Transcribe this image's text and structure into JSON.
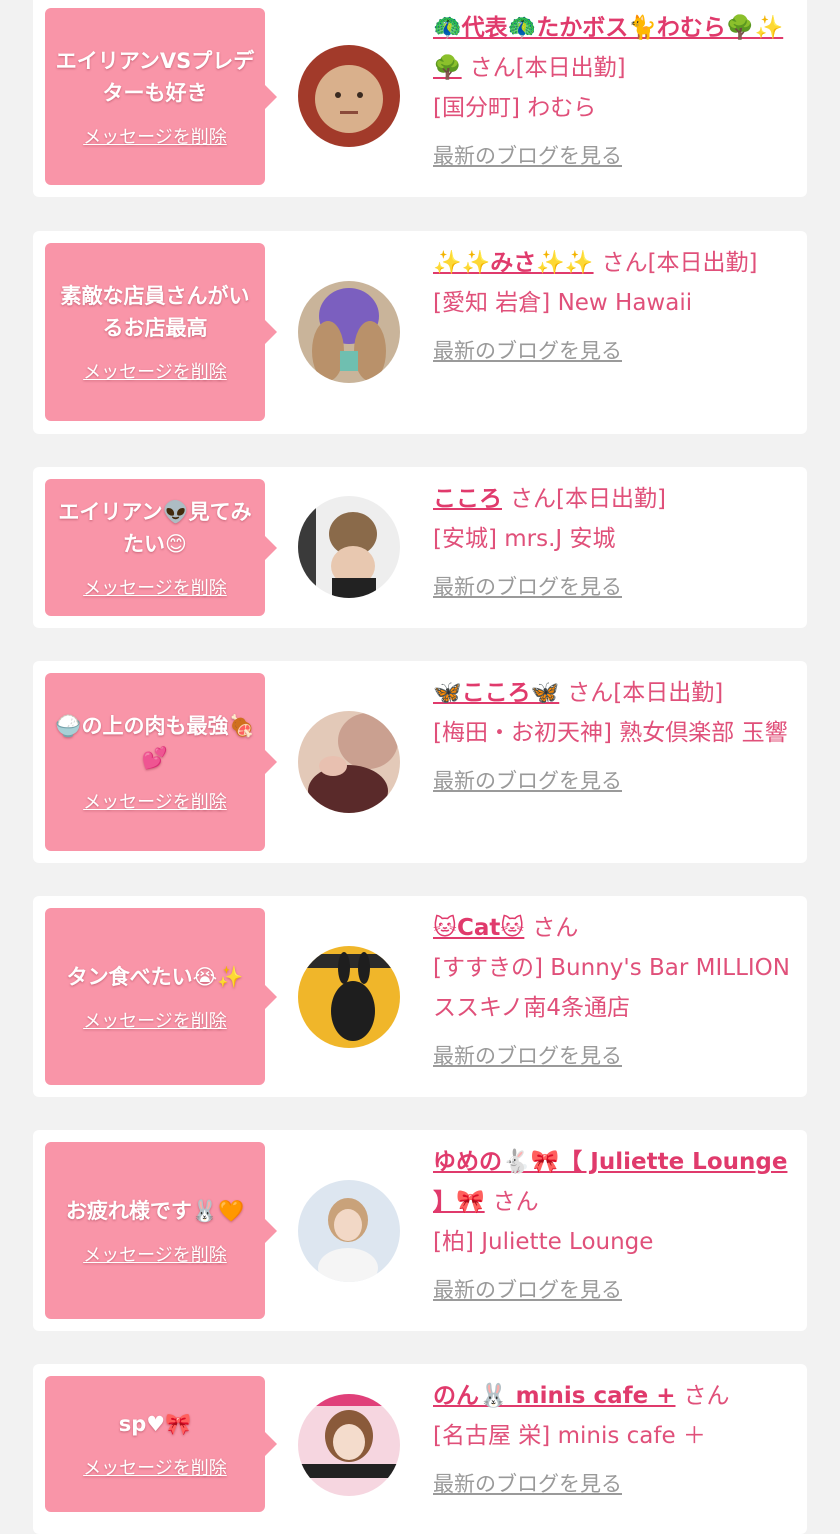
{
  "messages": [
    {
      "message": "エイリアンVSプレデターも好き",
      "delete_label": "メッセージを削除",
      "name": "🦚代表🦚たかボス🐈わむら🌳✨🌳",
      "honorific": "さん[本日出勤]",
      "shop": "[国分町] わむら",
      "blog_label": "最新のブログを見る"
    },
    {
      "message": "素敵な店員さんがいるお店最高",
      "delete_label": "メッセージを削除",
      "name": "✨✨みさ✨✨",
      "honorific": "さん[本日出勤]",
      "shop": "[愛知 岩倉] New Hawaii",
      "blog_label": "最新のブログを見る"
    },
    {
      "message": "エイリアン👽見てみたい😊",
      "delete_label": "メッセージを削除",
      "name": "こころ",
      "honorific": "さん[本日出勤]",
      "shop": "[安城] mrs.J 安城",
      "blog_label": "最新のブログを見る"
    },
    {
      "message": "🍚の上の肉も最強🍖💕",
      "delete_label": "メッセージを削除",
      "name": "🦋こころ🦋",
      "honorific": "さん[本日出勤]",
      "shop": "[梅田・お初天神] 熟女倶楽部 玉響",
      "blog_label": "最新のブログを見る"
    },
    {
      "message": "タン食べたい😭✨",
      "delete_label": "メッセージを削除",
      "name": "🐱Cat🐱",
      "honorific": "さん",
      "shop": "[すすきの] Bunny's Bar MILLION ススキノ南4条通店",
      "blog_label": "最新のブログを見る"
    },
    {
      "message": "お疲れ様です🐰🧡",
      "delete_label": "メッセージを削除",
      "name": "ゆめの🐇🎀【 Juliette Lounge 】🎀",
      "honorific": "さん",
      "shop": "[柏] Juliette Lounge",
      "blog_label": "最新のブログを見る"
    },
    {
      "message": "sp♥🎀",
      "delete_label": "メッセージを削除",
      "name": "のん🐰 minis cafe +",
      "honorific": "さん",
      "shop": "[名古屋 栄] minis cafe ＋",
      "blog_label": "最新のブログを見る"
    }
  ]
}
